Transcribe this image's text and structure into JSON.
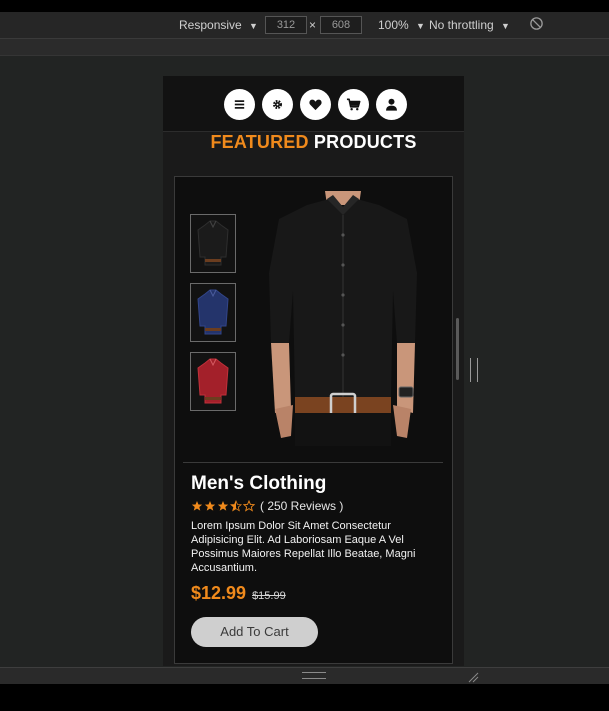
{
  "devtools": {
    "device_label": "Responsive",
    "width_value": "312",
    "separator": "×",
    "height_value": "608",
    "zoom_label": "100%",
    "throttle_label": "No throttling"
  },
  "navbar": {
    "icons": [
      "menu-icon",
      "settings-icon",
      "heart-icon",
      "cart-icon",
      "user-icon"
    ]
  },
  "section": {
    "title_accent": "FEATURED",
    "title_rest": " PRODUCTS"
  },
  "product": {
    "thumbnails": [
      {
        "color": "#1b1b1b"
      },
      {
        "color": "#24346b"
      },
      {
        "color": "#a3202a"
      }
    ],
    "title": "Men's Clothing",
    "rating": 3.5,
    "reviews": "( 250 Reviews )",
    "description": "Lorem Ipsum Dolor Sit Amet Consectetur Adipisicing Elit. Ad Laboriosam Eaque A Vel Possimus Maiores Repellat Illo Beatae, Magni Accusantium.",
    "price": "$12.99",
    "old_price": "$15.99",
    "cta_label": "Add To Cart"
  },
  "colors": {
    "accent": "#f08a1c",
    "card_bg": "#0e0e0e",
    "button_bg": "#cfcfcf"
  }
}
